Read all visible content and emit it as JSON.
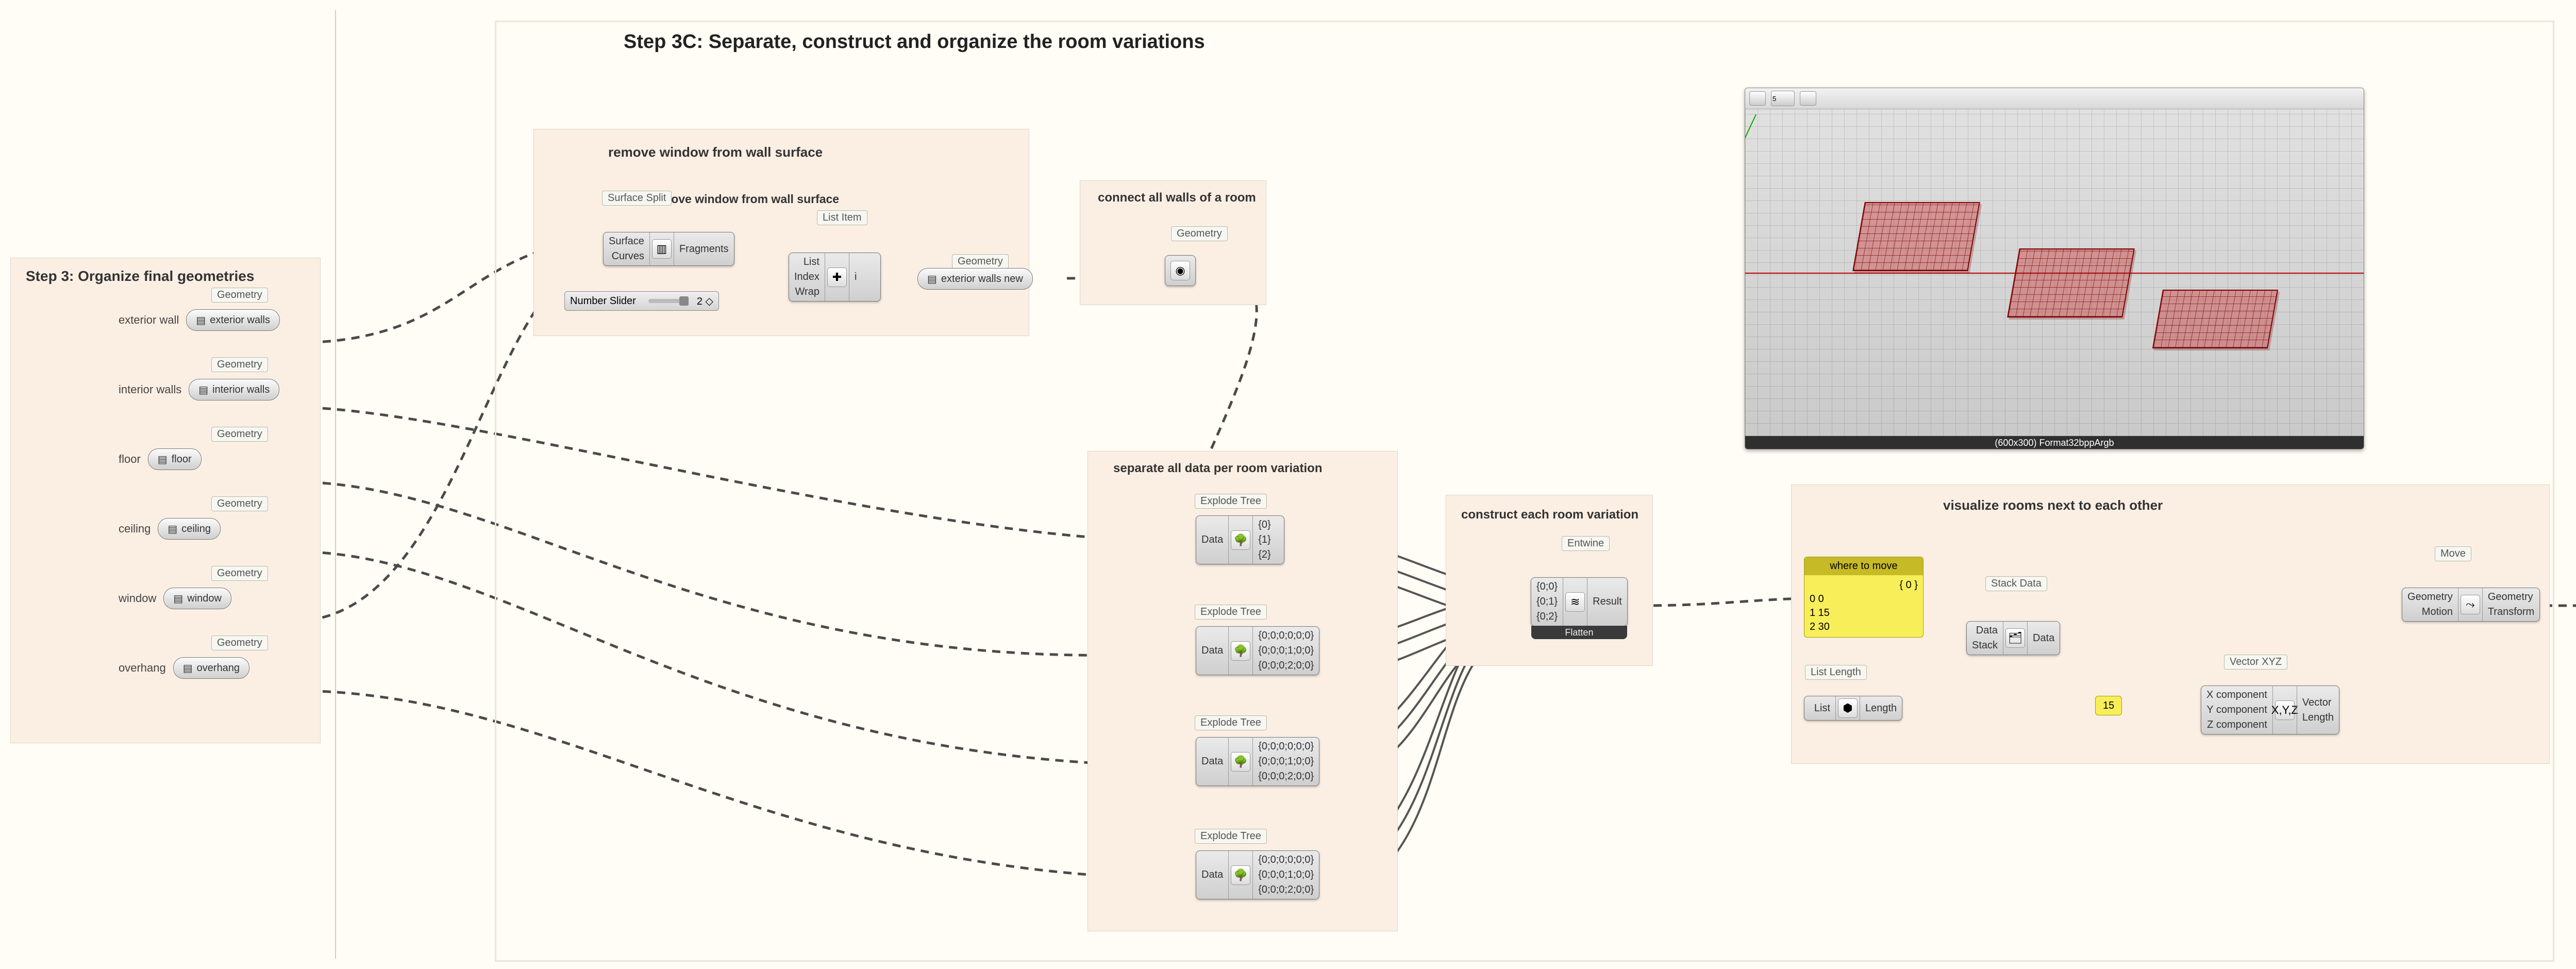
{
  "titles": {
    "main": "Step 3C: Separate, construct and organize the room variations",
    "g_left": "Step 3: Organize final geometries",
    "g_remove": "remove window from wall surface",
    "g_remove2": "remove window from wall surface",
    "g_connect": "connect all walls of a room",
    "g_sep": "separate all data per room variation",
    "g_construct": "construct each room variation",
    "g_visualize": "visualize rooms next to each other"
  },
  "tags": {
    "geometry": "Geometry",
    "surface_split": "Surface Split",
    "list_item": "List Item",
    "explode_tree": "Explode Tree",
    "entwine": "Entwine",
    "stack_data": "Stack Data",
    "list_length": "List Length",
    "vector_xyz": "Vector XYZ",
    "move": "Move"
  },
  "left_params": [
    {
      "label": "exterior wall",
      "value": "exterior walls"
    },
    {
      "label": "interior walls",
      "value": "interior walls"
    },
    {
      "label": "floor",
      "value": "floor"
    },
    {
      "label": "ceiling",
      "value": "ceiling"
    },
    {
      "label": "window",
      "value": "window"
    },
    {
      "label": "overhang",
      "value": "overhang"
    }
  ],
  "remove": {
    "surface_split": {
      "in": [
        "Surface",
        "Curves"
      ],
      "out": [
        "Fragments"
      ]
    },
    "number_slider": {
      "label": "Number Slider",
      "value": "2 ◇"
    },
    "list_item": {
      "in": [
        "List",
        "Index",
        "Wrap"
      ],
      "out": [
        "i"
      ]
    },
    "ext_walls_new": "exterior walls new"
  },
  "connect": {
    "in": [
      ""
    ],
    "out": [
      ""
    ]
  },
  "explode_trees": [
    {
      "in": "Data",
      "out": [
        "{0}",
        "{1}",
        "{2}"
      ]
    },
    {
      "in": "Data",
      "out": [
        "{0;0;0;0;0;0}",
        "{0;0;0;1;0;0}",
        "{0;0;0;2;0;0}"
      ]
    },
    {
      "in": "Data",
      "out": [
        "{0;0;0;0;0;0}",
        "{0;0;0;1;0;0}",
        "{0;0;0;2;0;0}"
      ]
    },
    {
      "in": "Data",
      "out": [
        "{0;0;0;0;0;0}",
        "{0;0;0;1;0;0}",
        "{0;0;0;2;0;0}"
      ]
    }
  ],
  "entwine": {
    "in": [
      "{0;0}",
      "{0;1}",
      "{0;2}"
    ],
    "out": "Result",
    "foot": "Flatten"
  },
  "where_to_move": {
    "head": "where to move",
    "col_head": "{ 0 }",
    "rows": [
      "0    0",
      "1    15",
      "2    30"
    ]
  },
  "stack_data": {
    "in": [
      "Data",
      "Stack"
    ],
    "out": "Data"
  },
  "list_length": {
    "in": "List",
    "out": "Length"
  },
  "value_15": "15",
  "vector_xyz": {
    "in": [
      "X component",
      "Y component",
      "Z component"
    ],
    "out": [
      "Vector",
      "Length"
    ],
    "label": "X,Y,Z"
  },
  "move_comp": {
    "in": [
      "Geometry",
      "Motion"
    ],
    "out": [
      "Geometry",
      "Transform"
    ]
  },
  "viewport": {
    "status": "(600x300) Format32bppArgb",
    "input_val": "5"
  }
}
